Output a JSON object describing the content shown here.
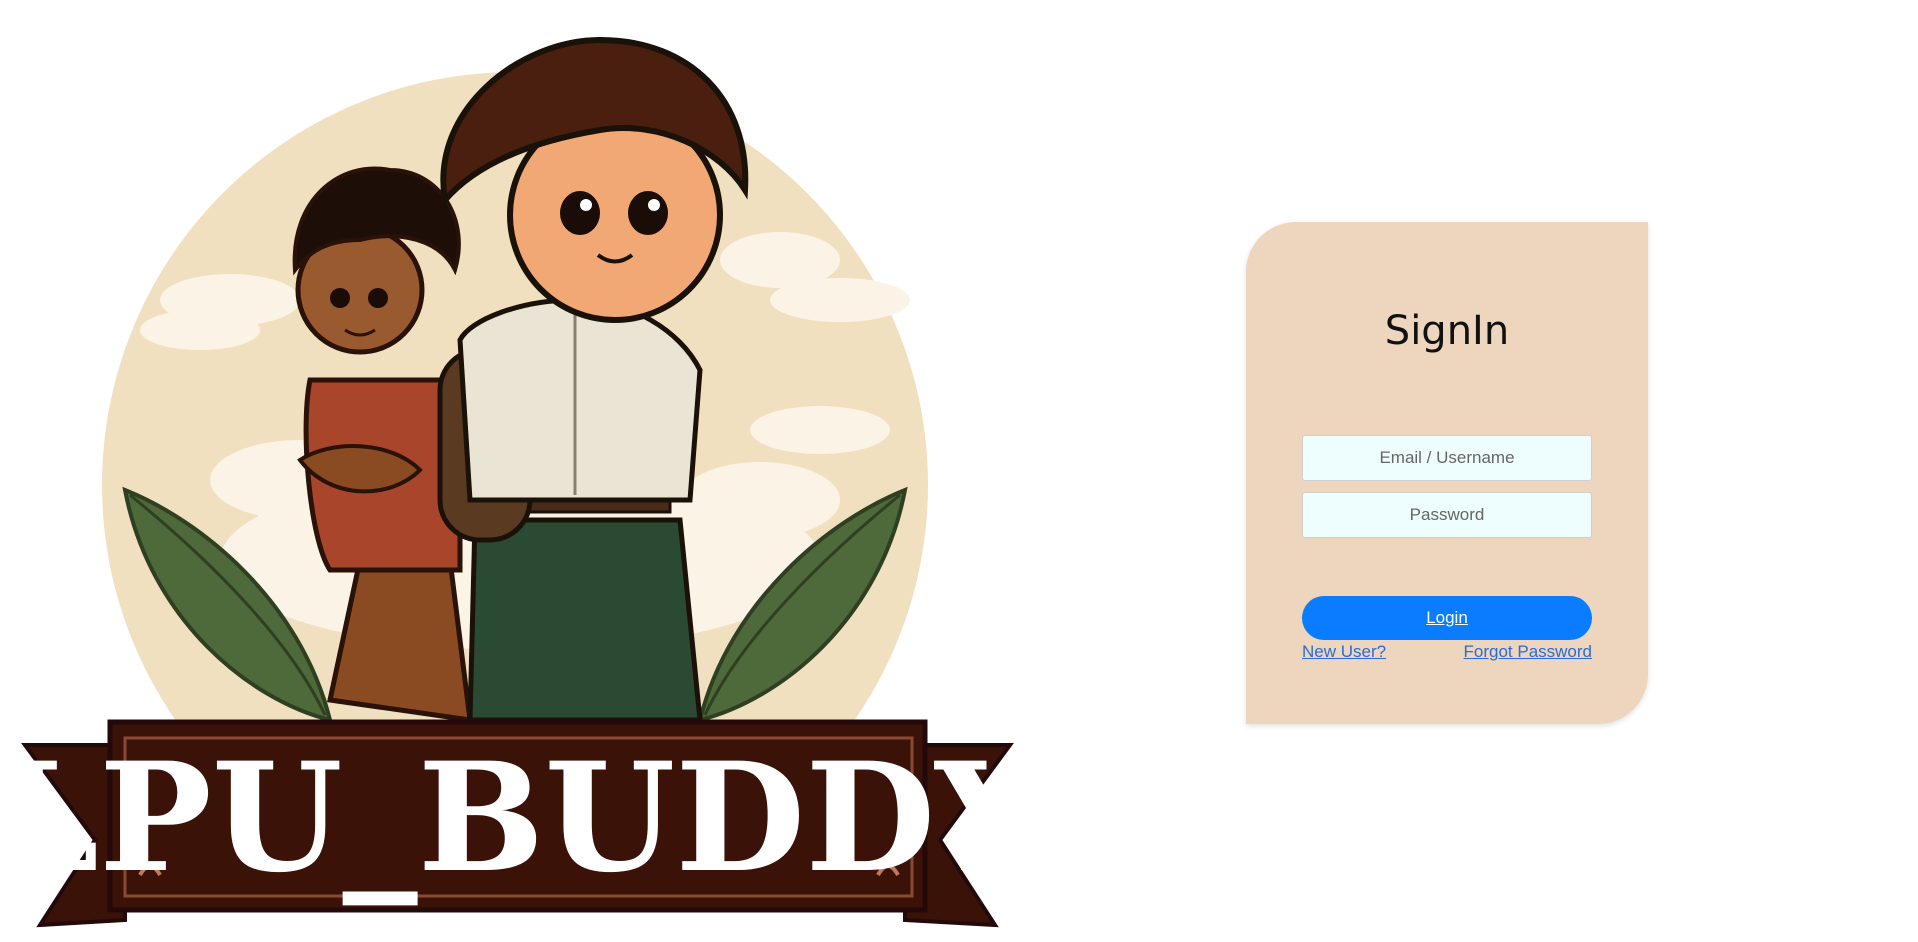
{
  "logo": {
    "brand_text": "LPU_BUDDY",
    "description_icon": "two-boys-mascot-illustration"
  },
  "signin": {
    "title": "SignIn",
    "email_placeholder": "Email / Username",
    "password_placeholder": "Password",
    "login_label": "Login",
    "new_user_label": "New User?",
    "forgot_password_label": "Forgot Password"
  },
  "colors": {
    "card_background": "#eed5bd",
    "input_background": "#eefdfd",
    "primary_button": "#0a7cff",
    "link": "#2a6cd6",
    "banner_dark": "#3a1208",
    "leaf_green": "#4f6a3a"
  }
}
